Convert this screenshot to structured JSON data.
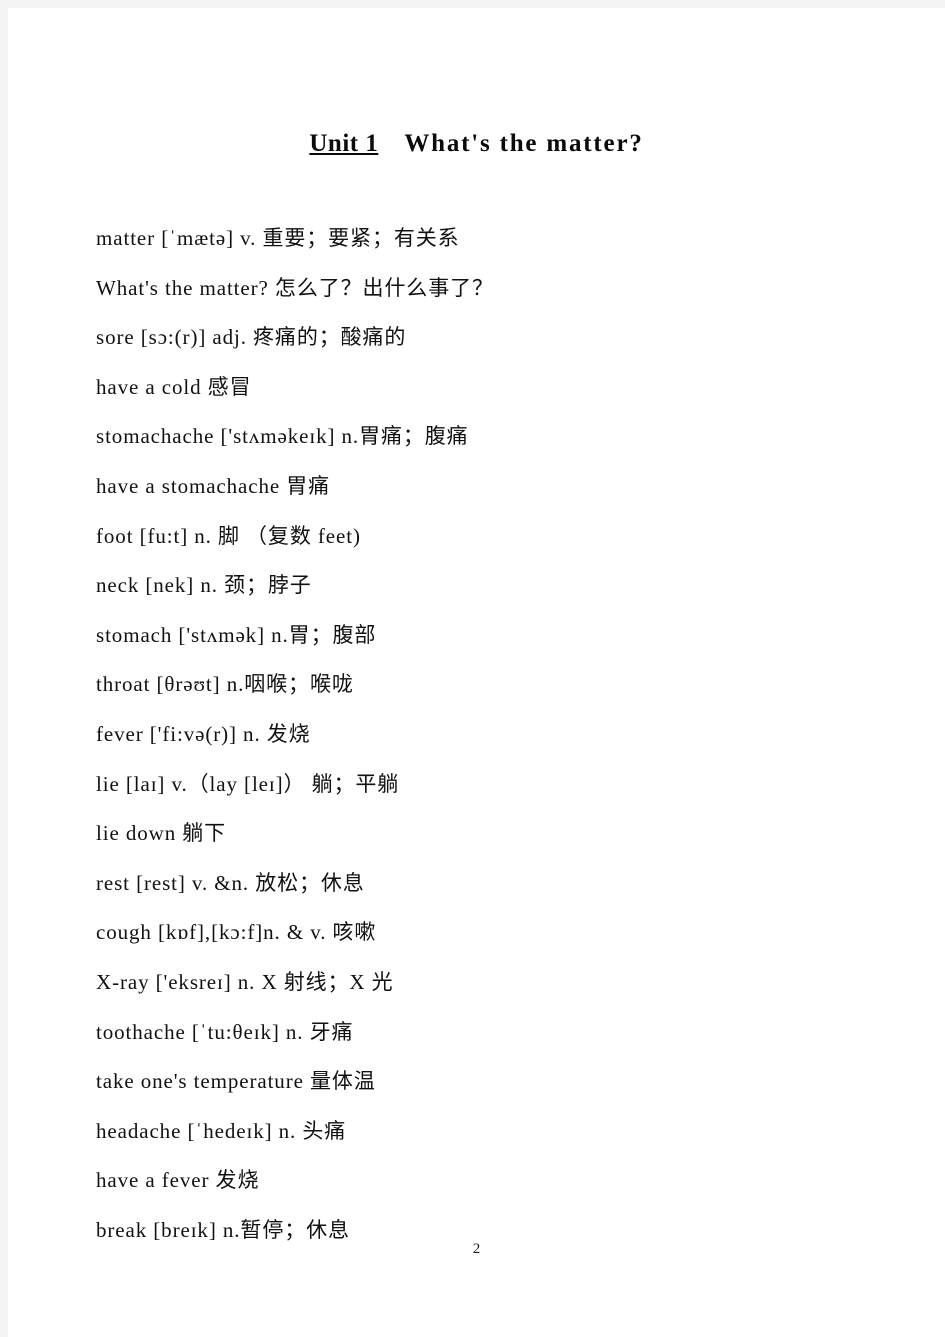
{
  "page": {
    "number": "2",
    "background_color": "#ffffff",
    "margin_color": "#f4f4f4"
  },
  "title": {
    "unit": "Unit 1",
    "topic": "What's the matter?"
  },
  "vocabulary": [
    {
      "text": "matter [ˈmætə] v.  重要；要紧；有关系"
    },
    {
      "text": "What's the matter?   怎么了？出什么事了？"
    },
    {
      "text": "sore [sɔ:(r)] adj. 疼痛的；酸痛的"
    },
    {
      "text": "have a cold   感冒"
    },
    {
      "text": "stomachache ['stʌməkeɪk] n.胃痛；腹痛"
    },
    {
      "text": "have a stomachache   胃痛"
    },
    {
      "text": "foot [fu:t] n. 脚  （复数 feet)"
    },
    {
      "text": "neck [nek] n. 颈；脖子"
    },
    {
      "text": "stomach ['stʌmək] n.胃；腹部"
    },
    {
      "text": "throat [θrəʊt] n.咽喉；喉咙"
    },
    {
      "text": "fever ['fi:və(r)] n. 发烧"
    },
    {
      "text": "lie [laɪ] v.（lay [leɪ]） 躺；平躺"
    },
    {
      "text": "lie down   躺下"
    },
    {
      "text": "rest [rest] v. &n. 放松；休息"
    },
    {
      "text": "cough [kɒf],[kɔ:f]n. & v. 咳嗽"
    },
    {
      "text": "X-ray ['eksreɪ] n. X 射线；X 光"
    },
    {
      "text": "toothache [ˈtu:θeɪk] n. 牙痛"
    },
    {
      "text": "take one's temperature   量体温"
    },
    {
      "text": "headache [ˈhedeɪk] n. 头痛"
    },
    {
      "text": "have a fever   发烧"
    },
    {
      "text": "break [breɪk] n.暂停；休息"
    }
  ]
}
